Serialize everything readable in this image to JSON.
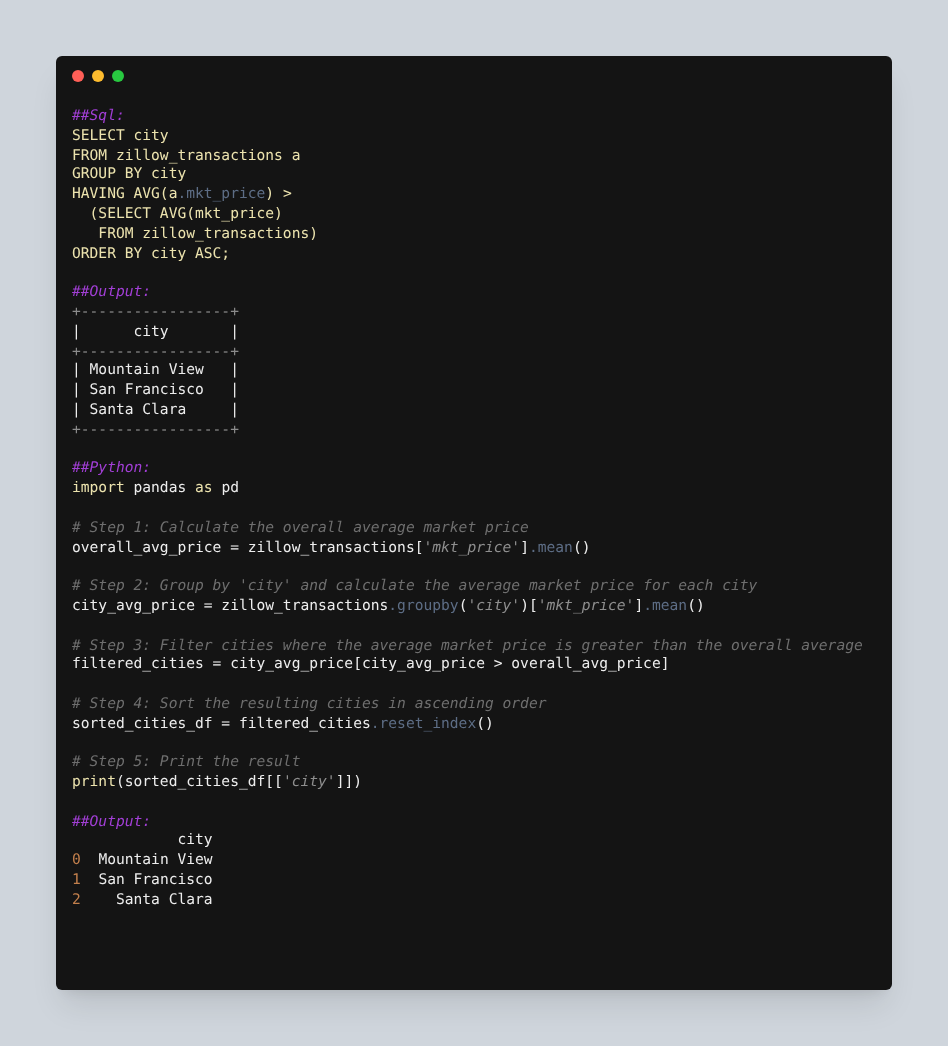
{
  "window": {
    "controls": [
      {
        "color": "#ff5f57"
      },
      {
        "color": "#febc2e"
      },
      {
        "color": "#28c840"
      }
    ]
  },
  "lines": [
    {
      "kind": "code",
      "tokens": [
        {
          "kind": "heading",
          "text": "##Sql:"
        }
      ]
    },
    {
      "kind": "code",
      "tokens": [
        {
          "kind": "keyword",
          "text": "SELECT city"
        }
      ]
    },
    {
      "kind": "code",
      "tokens": [
        {
          "kind": "keyword",
          "text": "FROM zillow_transactions a"
        }
      ]
    },
    {
      "kind": "code",
      "tokens": [
        {
          "kind": "keyword",
          "text": "GROUP BY city"
        }
      ]
    },
    {
      "kind": "code",
      "tokens": [
        {
          "kind": "keyword",
          "text": "HAVING AVG(a"
        },
        {
          "kind": "method",
          "text": ".mkt_price"
        },
        {
          "kind": "keyword",
          "text": ") >"
        }
      ]
    },
    {
      "kind": "code",
      "tokens": [
        {
          "kind": "keyword",
          "text": "  (SELECT AVG(mkt_price)"
        }
      ]
    },
    {
      "kind": "code",
      "tokens": [
        {
          "kind": "keyword",
          "text": "   FROM zillow_transactions)"
        }
      ]
    },
    {
      "kind": "code",
      "tokens": [
        {
          "kind": "keyword",
          "text": "ORDER BY city ASC;"
        }
      ]
    },
    {
      "kind": "blank"
    },
    {
      "kind": "code",
      "tokens": [
        {
          "kind": "heading",
          "text": "##Output:"
        }
      ]
    },
    {
      "kind": "code",
      "tokens": [
        {
          "kind": "border",
          "text": "+-----------------+"
        }
      ]
    },
    {
      "kind": "code",
      "tokens": [
        {
          "kind": "text",
          "text": "|      city       |"
        }
      ]
    },
    {
      "kind": "code",
      "tokens": [
        {
          "kind": "border",
          "text": "+-----------------+"
        }
      ]
    },
    {
      "kind": "code",
      "tokens": [
        {
          "kind": "text",
          "text": "| Mountain View   |"
        }
      ]
    },
    {
      "kind": "code",
      "tokens": [
        {
          "kind": "text",
          "text": "| San Francisco   |"
        }
      ]
    },
    {
      "kind": "code",
      "tokens": [
        {
          "kind": "text",
          "text": "| Santa Clara     |"
        }
      ]
    },
    {
      "kind": "code",
      "tokens": [
        {
          "kind": "border",
          "text": "+-----------------+"
        }
      ]
    },
    {
      "kind": "blank"
    },
    {
      "kind": "code",
      "tokens": [
        {
          "kind": "heading",
          "text": "##Python:"
        }
      ]
    },
    {
      "kind": "code",
      "tokens": [
        {
          "kind": "keyword",
          "text": "import"
        },
        {
          "kind": "text",
          "text": " pandas "
        },
        {
          "kind": "keyword",
          "text": "as"
        },
        {
          "kind": "text",
          "text": " pd"
        }
      ]
    },
    {
      "kind": "blank"
    },
    {
      "kind": "code",
      "tokens": [
        {
          "kind": "comment",
          "text": "# Step 1: Calculate the overall average market price"
        }
      ]
    },
    {
      "kind": "code",
      "tokens": [
        {
          "kind": "text",
          "text": "overall_avg_price = zillow_transactions["
        },
        {
          "kind": "string",
          "text": "'mkt_price'"
        },
        {
          "kind": "text",
          "text": "]"
        },
        {
          "kind": "method",
          "text": ".mean"
        },
        {
          "kind": "text",
          "text": "()"
        }
      ]
    },
    {
      "kind": "blank"
    },
    {
      "kind": "code",
      "tokens": [
        {
          "kind": "comment",
          "text": "# Step 2: Group by 'city' and calculate the average market price for each city"
        }
      ]
    },
    {
      "kind": "code",
      "tokens": [
        {
          "kind": "text",
          "text": "city_avg_price = zillow_transactions"
        },
        {
          "kind": "method",
          "text": ".groupby"
        },
        {
          "kind": "text",
          "text": "("
        },
        {
          "kind": "string",
          "text": "'city'"
        },
        {
          "kind": "text",
          "text": ")["
        },
        {
          "kind": "string",
          "text": "'mkt_price'"
        },
        {
          "kind": "text",
          "text": "]"
        },
        {
          "kind": "method",
          "text": ".mean"
        },
        {
          "kind": "text",
          "text": "()"
        }
      ]
    },
    {
      "kind": "blank"
    },
    {
      "kind": "code",
      "tokens": [
        {
          "kind": "comment",
          "text": "# Step 3: Filter cities where the average market price is greater than the overall average"
        }
      ]
    },
    {
      "kind": "code",
      "tokens": [
        {
          "kind": "text",
          "text": "filtered_cities = city_avg_price[city_avg_price > overall_avg_price]"
        }
      ]
    },
    {
      "kind": "blank"
    },
    {
      "kind": "code",
      "tokens": [
        {
          "kind": "comment",
          "text": "# Step 4: Sort the resulting cities in ascending order"
        }
      ]
    },
    {
      "kind": "code",
      "tokens": [
        {
          "kind": "text",
          "text": "sorted_cities_df = filtered_cities"
        },
        {
          "kind": "method",
          "text": ".reset_index"
        },
        {
          "kind": "text",
          "text": "()"
        }
      ]
    },
    {
      "kind": "blank"
    },
    {
      "kind": "code",
      "tokens": [
        {
          "kind": "comment",
          "text": "# Step 5: Print the result"
        }
      ]
    },
    {
      "kind": "code",
      "tokens": [
        {
          "kind": "keyword",
          "text": "print"
        },
        {
          "kind": "text",
          "text": "(sorted_cities_df[["
        },
        {
          "kind": "string",
          "text": "'city'"
        },
        {
          "kind": "text",
          "text": "]])"
        }
      ]
    },
    {
      "kind": "blank"
    },
    {
      "kind": "code",
      "tokens": [
        {
          "kind": "heading",
          "text": "##Output:"
        }
      ]
    },
    {
      "kind": "code",
      "tokens": [
        {
          "kind": "text",
          "text": "            city"
        }
      ]
    },
    {
      "kind": "code",
      "tokens": [
        {
          "kind": "number",
          "text": "0"
        },
        {
          "kind": "text",
          "text": "  Mountain View"
        }
      ]
    },
    {
      "kind": "code",
      "tokens": [
        {
          "kind": "number",
          "text": "1"
        },
        {
          "kind": "text",
          "text": "  San Francisco"
        }
      ]
    },
    {
      "kind": "code",
      "tokens": [
        {
          "kind": "number",
          "text": "2"
        },
        {
          "kind": "text",
          "text": "    Santa Clara"
        }
      ]
    }
  ]
}
